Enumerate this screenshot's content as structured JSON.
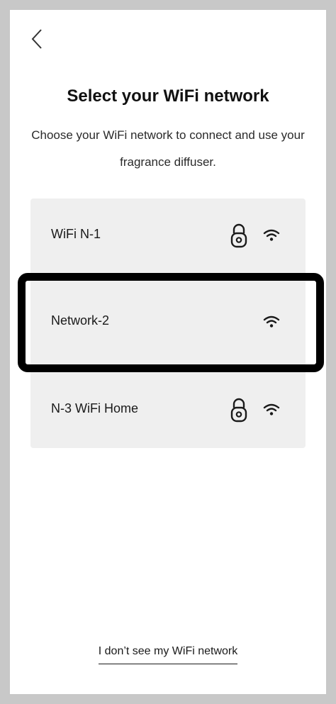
{
  "header": {
    "back_icon": "chevron-left-icon"
  },
  "page": {
    "title": "Select your WiFi network",
    "subtitle": "Choose your WiFi network to connect and use your fragrance diffuser."
  },
  "networks": [
    {
      "name": "WiFi N-1",
      "secured": true,
      "icon_lock": "lock-icon",
      "icon_signal": "wifi-icon"
    },
    {
      "name": "Network-2",
      "secured": false,
      "icon_signal": "wifi-icon",
      "highlighted": true
    },
    {
      "name": "N-3 WiFi Home",
      "secured": true,
      "icon_lock": "lock-icon",
      "icon_signal": "wifi-icon"
    }
  ],
  "footer": {
    "link_label": "I don’t see my WiFi network"
  },
  "colors": {
    "background_outer": "#c8c8c8",
    "screen": "#ffffff",
    "list_background": "#efefef",
    "highlight_border": "#000000",
    "text": "#1a1a1a"
  }
}
